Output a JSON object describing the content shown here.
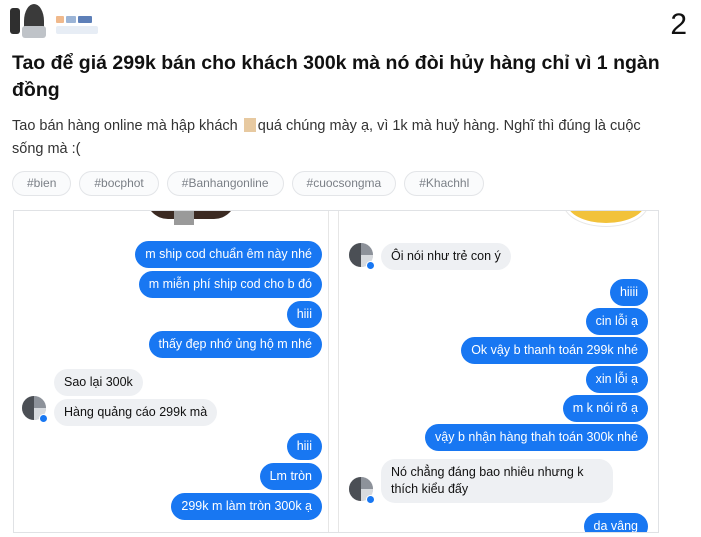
{
  "page_number": "2",
  "post": {
    "title": "Tao để giá 299k bán cho khách 300k mà nó đòi hủy hàng chỉ vì 1 ngàn đồng",
    "desc_before": "Tao bán hàng online mà hập khách ",
    "desc_after": "quá chúng mày ạ, vì 1k mà huỷ hàng. Nghĩ thì đúng là cuộc sống mà :(",
    "tags": [
      "#bien",
      "#bocphot",
      "#Banhangonline",
      "#cuocsongma",
      "#Khachhl"
    ]
  },
  "chat_left": {
    "messages": [
      {
        "side": "out",
        "text": "m ship cod chuẩn êm này nhé"
      },
      {
        "side": "out",
        "text": "m miễn phí ship cod cho b đó"
      },
      {
        "side": "out",
        "text": "hiii"
      },
      {
        "side": "out",
        "text": "thấy đẹp nhớ ủng hộ m nhé"
      },
      {
        "side": "in",
        "text": "Sao lại 300k"
      },
      {
        "side": "in",
        "text": "Hàng quảng cáo 299k mà"
      },
      {
        "side": "out",
        "text": "hiii"
      },
      {
        "side": "out",
        "text": "Lm tròn"
      },
      {
        "side": "out",
        "text": "299k m làm tròn 300k ạ"
      }
    ]
  },
  "chat_right": {
    "messages": [
      {
        "side": "in",
        "text": "Ôi nói như trẻ con ý"
      },
      {
        "side": "out",
        "text": "hiiii"
      },
      {
        "side": "out",
        "text": "cin lỗi ạ"
      },
      {
        "side": "out",
        "text": "Ok vậy b thanh toán 299k nhé"
      },
      {
        "side": "out",
        "text": "xin lỗi ạ"
      },
      {
        "side": "out",
        "text": "m k nói rõ ạ"
      },
      {
        "side": "out",
        "text": "vậy b nhận hàng thah toán 300k nhé"
      },
      {
        "side": "in",
        "text": "Nó chẳng đáng bao nhiêu nhưng  k thích kiểu đấy"
      },
      {
        "side": "out",
        "text": "da vâng"
      }
    ]
  },
  "colors": {
    "outgoing_bubble": "#1877f2",
    "incoming_bubble": "#eef0f3",
    "tag_text": "#7a7f86"
  }
}
